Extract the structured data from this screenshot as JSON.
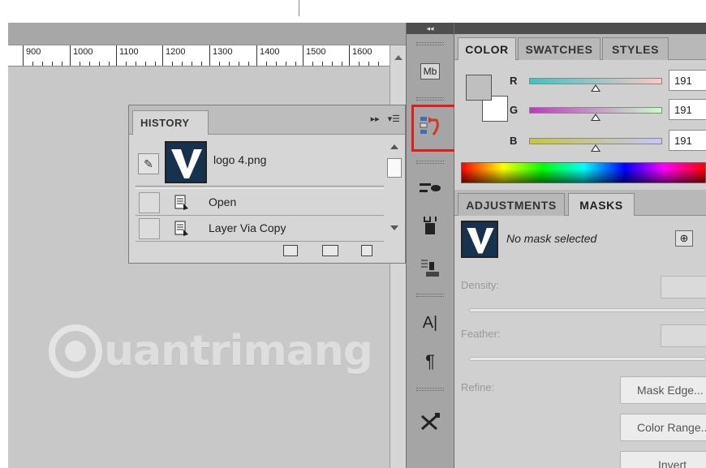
{
  "ruler": {
    "labels": [
      "900",
      "1000",
      "1100",
      "1200",
      "1300",
      "1400",
      "1500",
      "1600"
    ]
  },
  "watermark": {
    "text": "uantrimang"
  },
  "history": {
    "tab_label": "HISTORY",
    "menu_arrows": "▸▸",
    "menu_icon": "▾☰",
    "snapshot_label": "logo 4.png",
    "rows": [
      {
        "label": "Open"
      },
      {
        "label": "Layer Via Copy"
      }
    ]
  },
  "dock": {
    "collapse_label": "◂◂",
    "mini_bridge_label": "Mb",
    "icons": [
      "mini-bridge-icon",
      "history-icon",
      "brush-presets-icon",
      "clone-source-icon",
      "tool-presets-icon",
      "character-icon",
      "paragraph-icon",
      "tools-icon"
    ],
    "character_glyph": "A|",
    "paragraph_glyph": "¶"
  },
  "color_panel": {
    "tabs": [
      "COLOR",
      "SWATCHES",
      "STYLES"
    ],
    "active_tab": "COLOR",
    "channels": [
      {
        "name": "R",
        "value": "191"
      },
      {
        "name": "G",
        "value": "191"
      },
      {
        "name": "B",
        "value": "191"
      }
    ],
    "colors": {
      "foreground": "#bfbfbf",
      "background": "#ffffff",
      "r_gradient": [
        "#33c7c7",
        "#ffc6c6"
      ],
      "g_gradient": [
        "#c733c7",
        "#c6ffc6"
      ],
      "b_gradient": [
        "#c7c733",
        "#c6c6ff"
      ]
    }
  },
  "adjust_panel": {
    "tabs": [
      "ADJUSTMENTS",
      "MASKS"
    ],
    "active_tab": "MASKS",
    "mask_status": "No mask selected",
    "density_label": "Density:",
    "feather_label": "Feather:",
    "refine_label": "Refine:",
    "buttons": [
      "Mask Edge...",
      "Color Range...",
      "Invert"
    ]
  },
  "accent": {
    "highlight": "#e21c1c",
    "logo_navy": "#17324f"
  }
}
